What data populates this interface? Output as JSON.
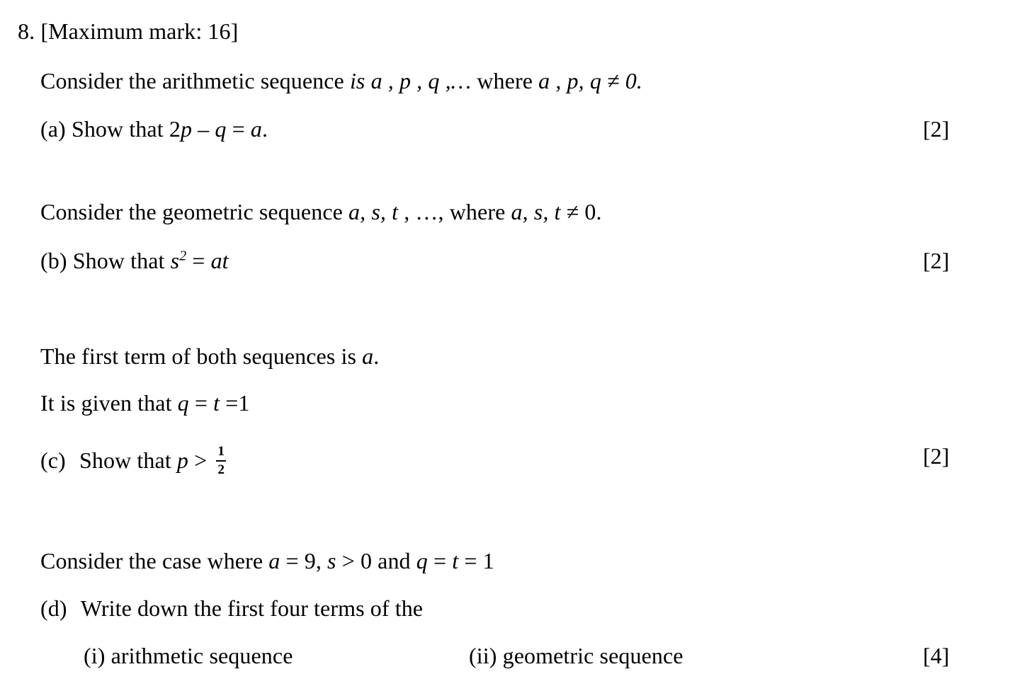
{
  "document": {
    "type": "exam-question",
    "background_color": "#ffffff",
    "text_color": "#000000"
  },
  "question": {
    "number": "8.",
    "max_mark_label": "[Maximum mark: 16]",
    "max_mark_value": 16
  },
  "arithmetic": {
    "intro_prefix": "Consider the arithmetic sequence ",
    "intro_italic": "is",
    "intro_vars": " a , p , q ,… ",
    "intro_where": "where ",
    "intro_condition": "a , p, q ≠ 0.",
    "part_label": "(a)",
    "part_text": "Show that 2",
    "part_expr_p": "p",
    "part_expr_mid": " – ",
    "part_expr_q": "q",
    "part_expr_eq": " = ",
    "part_expr_a": "a",
    "part_expr_end": ".",
    "marks": "[2]"
  },
  "geometric": {
    "intro_prefix": "Consider the geometric sequence ",
    "intro_vars": "a, s, t ",
    "intro_mid": ", …, ",
    "intro_where": "where ",
    "intro_condition_vars": "a, s, t",
    "intro_condition_rest": " ≠ 0.",
    "part_label": "(b)",
    "part_text": "Show that ",
    "part_expr_s": "s",
    "part_expr_sup": "2",
    "part_expr_eq": " = ",
    "part_expr_at": "at",
    "marks": "[2]"
  },
  "common": {
    "first_term_prefix": "The first term of both sequences is ",
    "first_term_var": "a",
    "first_term_end": ".",
    "given_prefix": "It is given that ",
    "given_q": "q",
    "given_eq1": " = ",
    "given_t": "t",
    "given_eq2": " =1",
    "part_label": "(c)",
    "part_text": "Show that ",
    "part_var_p": "p",
    "part_gt": " > ",
    "fraction_numerator": "1",
    "fraction_denominator": "2",
    "marks": "[2]"
  },
  "case": {
    "intro_prefix": "Consider the case where ",
    "intro_a": "a",
    "intro_a_val": " = 9, ",
    "intro_s": "s",
    "intro_s_val": " > 0 and ",
    "intro_q": "q",
    "intro_eq1": " = ",
    "intro_t": "t",
    "intro_eq2": " = 1",
    "part_label": "(d)",
    "part_text": "Write down the first four terms of the",
    "sub_i_label": "(i)",
    "sub_i_text": "arithmetic sequence",
    "sub_ii_label": "(ii)",
    "sub_ii_text": "geometric sequence",
    "marks": "[4]"
  }
}
